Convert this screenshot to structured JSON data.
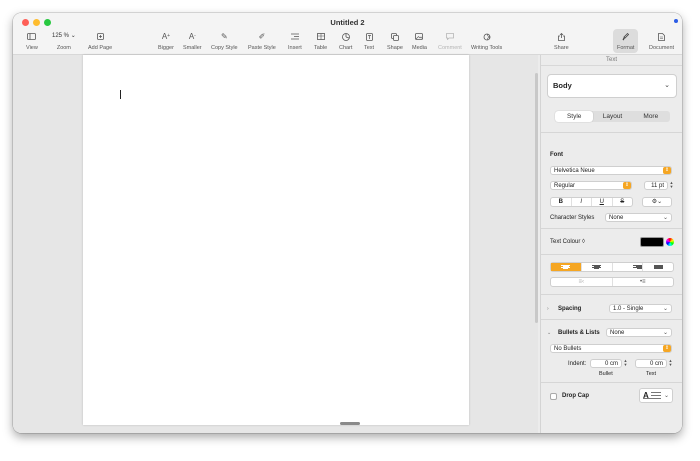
{
  "window": {
    "title": "Untitled 2"
  },
  "toolbar": {
    "view": "View",
    "zoom_value": "125 %",
    "zoom": "Zoom",
    "add_page": "Add Page",
    "bigger": "Bigger",
    "smaller": "Smaller",
    "copy_style": "Copy Style",
    "paste_style": "Paste Style",
    "insert": "Insert",
    "table": "Table",
    "chart": "Chart",
    "text": "Text",
    "shape": "Shape",
    "media": "Media",
    "comment": "Comment",
    "writing_tools": "Writing Tools",
    "share": "Share",
    "format": "Format",
    "document": "Document"
  },
  "inspector": {
    "header": "Text",
    "paragraph_style": "Body",
    "tabs": [
      "Style",
      "Layout",
      "More"
    ],
    "font_heading": "Font",
    "font_name": "Helvetica Neue",
    "font_weight": "Regular",
    "font_size": "11 pt",
    "format_buttons": [
      "B",
      "I",
      "U",
      "S"
    ],
    "character_styles_label": "Character Styles",
    "character_styles_value": "None",
    "text_colour_label": "Text Colour ◊",
    "text_colour": "#000000",
    "spacing_label": "Spacing",
    "spacing_value": "1.0 - Single",
    "bullets_label": "Bullets & Lists",
    "bullets_value": "None",
    "bullet_type": "No Bullets",
    "indent_label": "Indent:",
    "bullet_indent": "0 cm",
    "text_indent": "0 cm",
    "bullet_caption": "Bullet",
    "text_caption": "Text",
    "drop_cap_label": "Drop Cap",
    "drop_cap_letter": "A"
  }
}
